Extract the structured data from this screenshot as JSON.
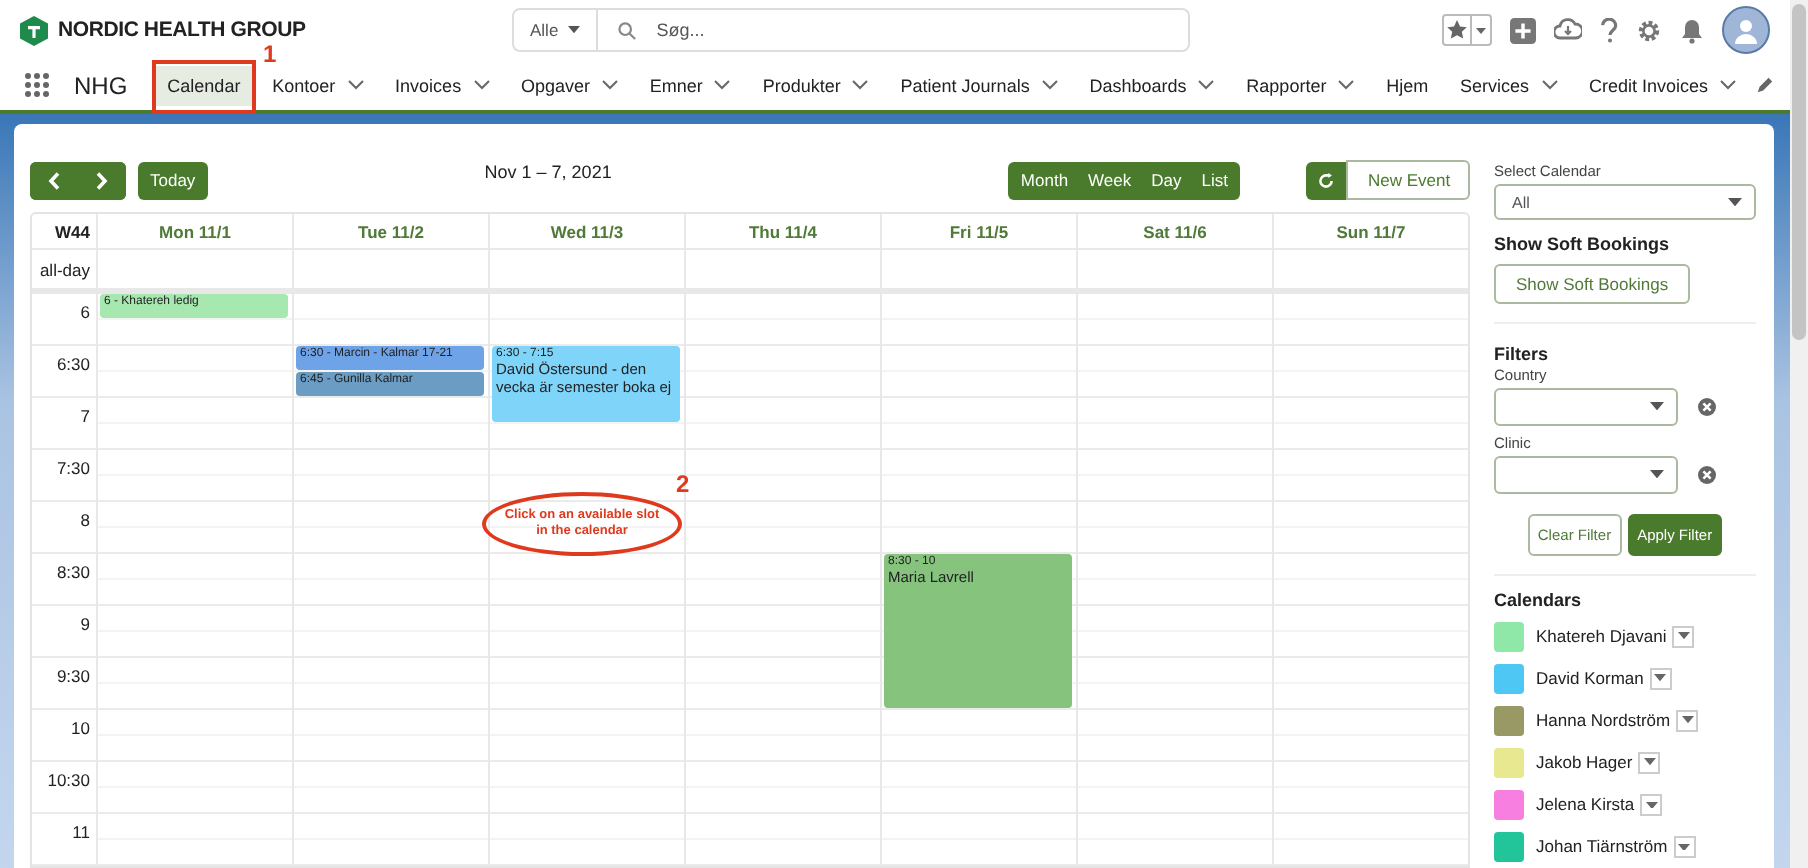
{
  "header": {
    "logo": "NORDIC HEALTH GROUP",
    "search_scope": "Alle",
    "search": {
      "placeholder": "Søg..."
    }
  },
  "nav": {
    "app_name": "NHG",
    "items": [
      {
        "label": "Calendar",
        "selected": true,
        "menu": false
      },
      {
        "label": "Kontoer",
        "selected": false,
        "menu": true
      },
      {
        "label": "Invoices",
        "selected": false,
        "menu": true
      },
      {
        "label": "Opgaver",
        "selected": false,
        "menu": true
      },
      {
        "label": "Emner",
        "selected": false,
        "menu": true
      },
      {
        "label": "Produkter",
        "selected": false,
        "menu": true
      },
      {
        "label": "Patient Journals",
        "selected": false,
        "menu": true
      },
      {
        "label": "Dashboards",
        "selected": false,
        "menu": true
      },
      {
        "label": "Rapporter",
        "selected": false,
        "menu": true
      },
      {
        "label": "Hjem",
        "selected": false,
        "menu": false
      },
      {
        "label": "Services",
        "selected": false,
        "menu": true
      },
      {
        "label": "Credit Invoices",
        "selected": false,
        "menu": true
      }
    ]
  },
  "toolbar": {
    "today": "Today",
    "title": "Nov 1 – 7, 2021",
    "views": [
      "Month",
      "Week",
      "Day",
      "List"
    ],
    "new_event": "New Event"
  },
  "calendar": {
    "week": "W44",
    "all_day": "all-day",
    "times": [
      "6",
      "6:30",
      "7",
      "7:30",
      "8",
      "8:30",
      "9",
      "9:30",
      "10",
      "10:30",
      "11"
    ],
    "days": [
      {
        "label": "Mon 11/1",
        "events": [
          {
            "kind": "inline",
            "text": "6 - Khatereh ledig",
            "color": "#a6e8b0"
          }
        ]
      },
      {
        "label": "Tue 11/2",
        "events": [
          {
            "kind": "inline",
            "text": "6:30 - Marcin - Kalmar 17-21",
            "color": "#6fa3e8"
          },
          {
            "kind": "inline",
            "text": "6:45 - Gunilla Kalmar",
            "color": "#6a9cc4"
          }
        ]
      },
      {
        "label": "Wed 11/3",
        "events": [
          {
            "kind": "block",
            "time": "6:30 - 7:15",
            "title": "David Östersund - den vecka är semester boka ej",
            "color": "#7fd4fa"
          }
        ]
      },
      {
        "label": "Thu 11/4"
      },
      {
        "label": "Fri 11/5",
        "events": [
          {
            "kind": "block",
            "time": "8:30 - 10",
            "title": "Maria Lavrell",
            "color": "#86c47e"
          }
        ]
      },
      {
        "label": "Sat 11/6"
      },
      {
        "label": "Sun 11/7"
      }
    ]
  },
  "annotations": [
    {
      "number": "1"
    },
    {
      "number": "2",
      "text": "Click on an available slot in the calendar"
    }
  ],
  "sidebar": {
    "select_calendar": {
      "label": "Select Calendar",
      "value": "All"
    },
    "soft_bookings": {
      "heading": "Show Soft Bookings",
      "button": "Show Soft Bookings"
    },
    "filters": {
      "heading": "Filters",
      "fields": [
        {
          "label": "Country"
        },
        {
          "label": "Clinic"
        }
      ],
      "clear": "Clear Filter",
      "apply": "Apply Filter"
    },
    "calendars": {
      "heading": "Calendars",
      "items": [
        {
          "name": "Khatereh Djavani",
          "color": "#90e8a8"
        },
        {
          "name": "David Korman",
          "color": "#4fc7f5"
        },
        {
          "name": "Hanna Nordström",
          "color": "#999966"
        },
        {
          "name": "Jakob Hager",
          "color": "#e8e890"
        },
        {
          "name": "Jelena Kirsta",
          "color": "#f77fe0"
        },
        {
          "name": "Johan Tiärnström",
          "color": "#22c49a"
        }
      ]
    }
  }
}
